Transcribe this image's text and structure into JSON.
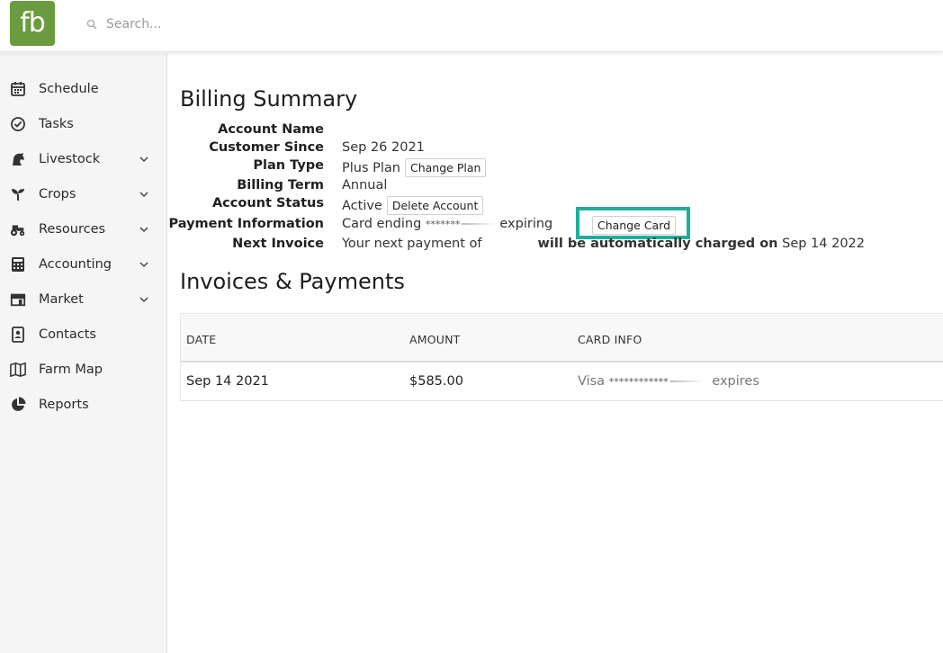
{
  "logo": {
    "text": "fb"
  },
  "search": {
    "placeholder": "Search..."
  },
  "sidebar": {
    "items": [
      {
        "label": "Schedule",
        "icon": "calendar-icon",
        "expandable": false
      },
      {
        "label": "Tasks",
        "icon": "check-circle-icon",
        "expandable": false
      },
      {
        "label": "Livestock",
        "icon": "horse-icon",
        "expandable": true
      },
      {
        "label": "Crops",
        "icon": "seedling-icon",
        "expandable": true
      },
      {
        "label": "Resources",
        "icon": "tractor-icon",
        "expandable": true
      },
      {
        "label": "Accounting",
        "icon": "calculator-icon",
        "expandable": true
      },
      {
        "label": "Market",
        "icon": "store-icon",
        "expandable": true
      },
      {
        "label": "Contacts",
        "icon": "address-book-icon",
        "expandable": false
      },
      {
        "label": "Farm Map",
        "icon": "map-icon",
        "expandable": false
      },
      {
        "label": "Reports",
        "icon": "pie-chart-icon",
        "expandable": false
      }
    ]
  },
  "billing": {
    "title": "Billing Summary",
    "account_name_label": "Account Name",
    "account_name_value": "",
    "customer_since_label": "Customer Since",
    "customer_since_value": "Sep 26 2021",
    "plan_type_label": "Plan Type",
    "plan_type_value": "Plus Plan",
    "change_plan_label": "Change Plan",
    "billing_term_label": "Billing Term",
    "billing_term_value": "Annual",
    "account_status_label": "Account Status",
    "account_status_value": "Active",
    "delete_account_label": "Delete Account",
    "payment_info_label": "Payment Information",
    "card_ending_text": "Card ending",
    "card_mask": "*******",
    "expiring_text": "expiring",
    "change_card_label": "Change Card",
    "next_invoice_label": "Next Invoice",
    "next_payment_text": "Your next payment of",
    "auto_charge_text": "will be automatically charged on",
    "next_charge_date": "Sep 14 2022"
  },
  "invoices": {
    "title": "Invoices & Payments",
    "columns": [
      "DATE",
      "AMOUNT",
      "CARD INFO"
    ],
    "rows": [
      {
        "date": "Sep 14 2021",
        "amount": "$585.00",
        "card_brand": "Visa",
        "card_mask": "************",
        "expires_text": "expires"
      }
    ]
  },
  "colors": {
    "logo_bg": "#6a9b3e",
    "highlight": "#1fae9b"
  }
}
